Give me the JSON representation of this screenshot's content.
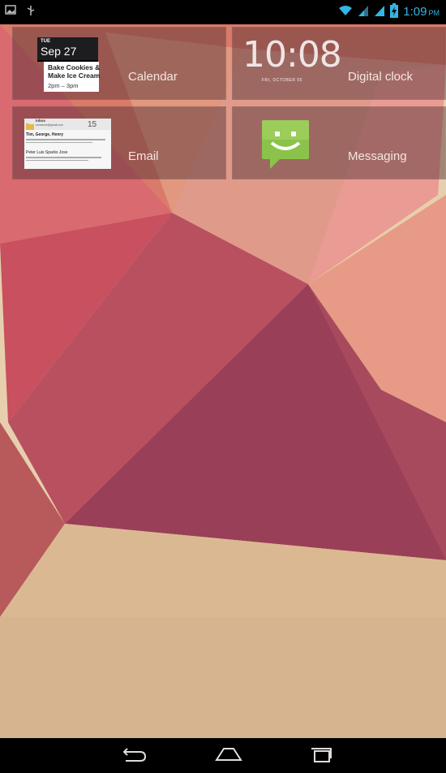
{
  "status_bar": {
    "time": "1:09",
    "ampm": "PM",
    "notification_icons": [
      "image-icon",
      "usb-icon"
    ],
    "system_icons": [
      "wifi-icon",
      "signal-icon",
      "signal-icon",
      "battery-icon"
    ],
    "accent_color": "#33b5e5"
  },
  "widgets": {
    "calendar": {
      "label": "Calendar",
      "preview": {
        "day_of_week": "TUE",
        "date": "Sep 27",
        "event_title_line1": "Bake Cookies &",
        "event_title_line2": "Make Ice Cream",
        "event_time": "2pm – 3pm"
      }
    },
    "digital_clock": {
      "label": "Digital clock",
      "preview": {
        "time": "10:08",
        "date": "FRI, OCTOBER 05"
      }
    },
    "email": {
      "label": "Email",
      "preview": {
        "folder": "Inbox",
        "account": "someone@gmail.com",
        "count": "15",
        "sender1": "Tim, George, Henry",
        "sender2": "Peter Luis Sparks Jose"
      }
    },
    "messaging": {
      "label": "Messaging",
      "icon": "smiley-message-icon",
      "icon_color": "#8bc34a"
    }
  },
  "nav_bar": {
    "buttons": [
      "back-icon",
      "home-icon",
      "recent-apps-icon"
    ]
  }
}
